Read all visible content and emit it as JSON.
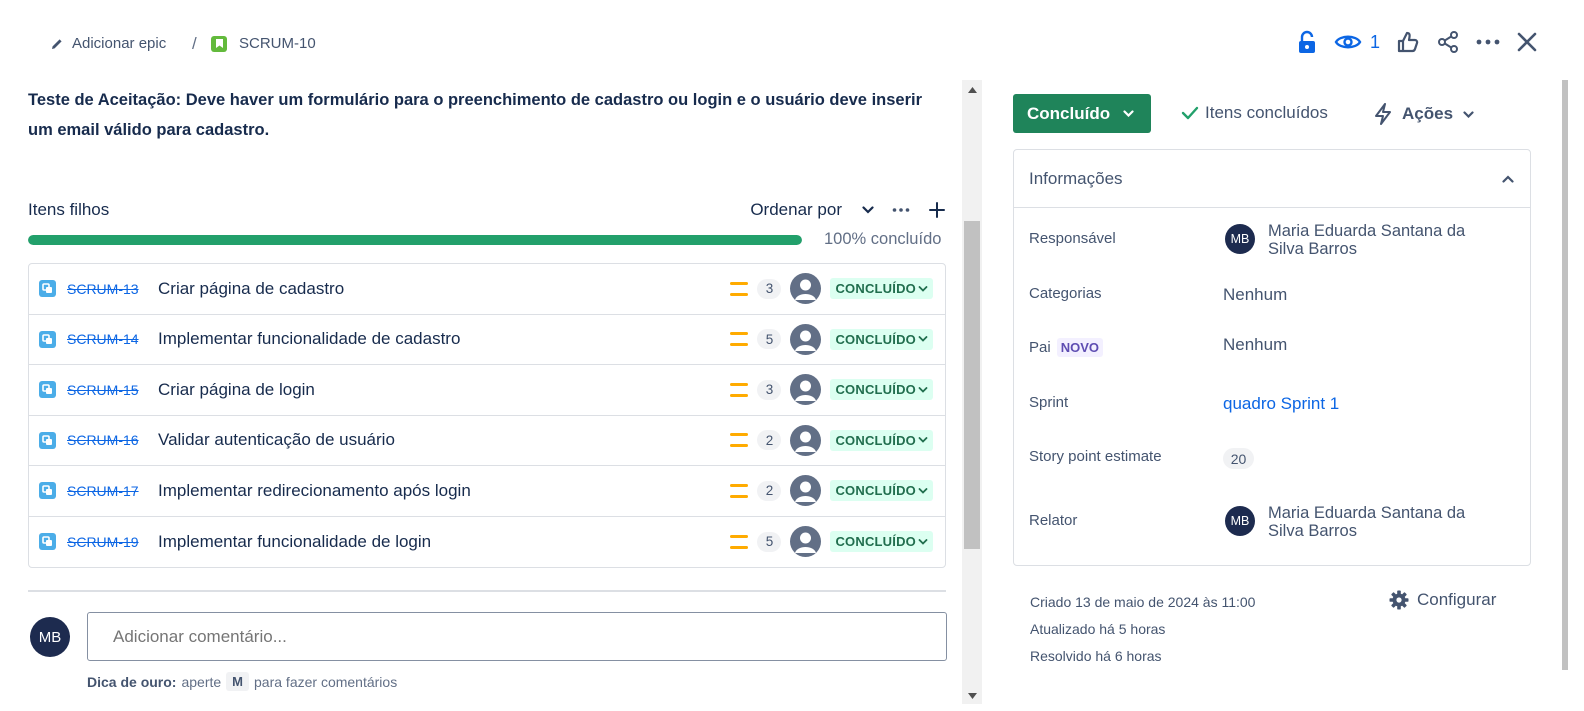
{
  "breadcrumb": {
    "epic_label": "Adicionar epic",
    "separator": "/",
    "issue_key": "SCRUM-10"
  },
  "top_actions": {
    "watch_count": "1",
    "icons": [
      "unlock-icon",
      "eye-icon",
      "thumbs-up-icon",
      "share-icon",
      "more-icon",
      "close-icon"
    ]
  },
  "description": "Teste de Aceitação: Deve haver um formulário para o preenchimento de cadastro ou login e o usuário deve inserir um email válido para cadastro.",
  "child_items": {
    "title": "Itens filhos",
    "order_label": "Ordenar por",
    "progress": 1.0,
    "progress_label": "100% concluído",
    "rows": [
      {
        "key": "SCRUM-13",
        "summary": "Criar página de cadastro",
        "points": "3",
        "status": "CONCLUÍDO"
      },
      {
        "key": "SCRUM-14",
        "summary": "Implementar funcionalidade de cadastro",
        "points": "5",
        "status": "CONCLUÍDO"
      },
      {
        "key": "SCRUM-15",
        "summary": "Criar página de login",
        "points": "3",
        "status": "CONCLUÍDO"
      },
      {
        "key": "SCRUM-16",
        "summary": "Validar autenticação de usuário",
        "points": "2",
        "status": "CONCLUÍDO"
      },
      {
        "key": "SCRUM-17",
        "summary": "Implementar redirecionamento após login",
        "points": "2",
        "status": "CONCLUÍDO"
      },
      {
        "key": "SCRUM-19",
        "summary": "Implementar funcionalidade de login",
        "points": "5",
        "status": "CONCLUÍDO"
      }
    ]
  },
  "comment": {
    "avatar_initials": "MB",
    "placeholder": "Adicionar comentário...",
    "tip_bold": "Dica de ouro:",
    "tip_pre": "aperte",
    "tip_key": "M",
    "tip_post": "para fazer comentários"
  },
  "status_panel": {
    "status_label": "Concluído",
    "done_items_label": "Itens concluídos",
    "actions_label": "Ações"
  },
  "info": {
    "title": "Informações",
    "assignee_label": "Responsável",
    "assignee_initials": "MB",
    "assignee_name": "Maria Eduarda Santana da Silva Barros",
    "categories_label": "Categorias",
    "categories_value": "Nenhum",
    "parent_label": "Pai",
    "parent_badge": "NOVO",
    "parent_value": "Nenhum",
    "sprint_label": "Sprint",
    "sprint_value": "quadro Sprint 1",
    "story_points_label": "Story point estimate",
    "story_points_value": "20",
    "reporter_label": "Relator",
    "reporter_initials": "MB",
    "reporter_name": "Maria Eduarda Santana da Silva Barros"
  },
  "meta": {
    "created": "Criado 13 de maio de 2024 às 11:00",
    "updated": "Atualizado há 5 horas",
    "resolved": "Resolvido há 6 horas",
    "configure_label": "Configurar"
  },
  "colors": {
    "done_green": "#1f845a",
    "progress_green": "#22a06b",
    "link_blue": "#0c66e4",
    "priority_medium": "#ffab00",
    "avatar_navy": "#1d2b4f"
  }
}
